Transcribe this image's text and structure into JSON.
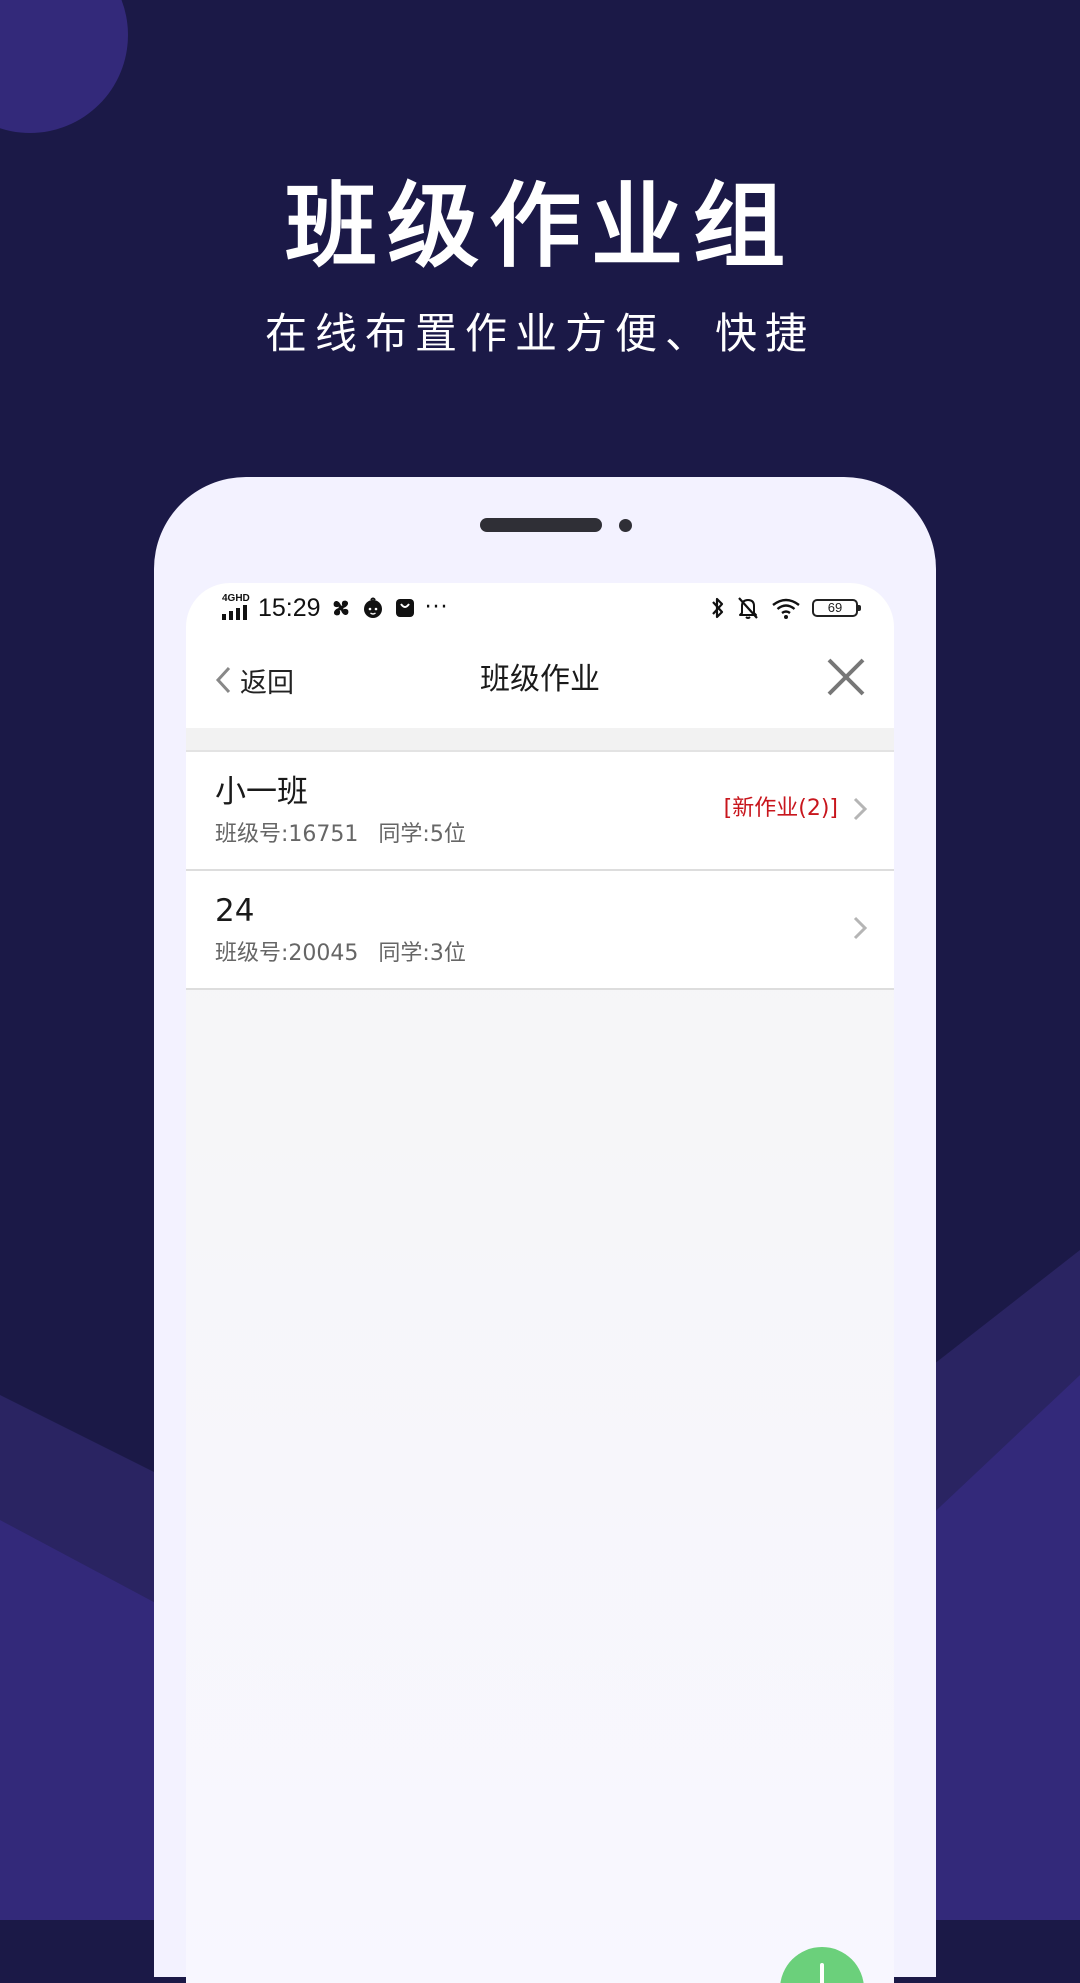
{
  "headline": {
    "title": "班级作业组",
    "subtitle": "在线布置作业方便、快捷"
  },
  "status_bar": {
    "network": "4GHD",
    "time": "15:29",
    "overflow": "···",
    "battery": "69"
  },
  "nav": {
    "back_label": "返回",
    "title": "班级作业"
  },
  "classes": [
    {
      "name": "小一班",
      "class_no": "班级号:16751",
      "students": "同学:5位",
      "badge": "[新作业(2)]"
    },
    {
      "name": "24",
      "class_no": "班级号:20045",
      "students": "同学:3位",
      "badge": ""
    }
  ],
  "colors": {
    "background": "#1b1947",
    "accent_purple": "#33297a",
    "badge_red": "#c8161d",
    "fab_green": "#6bd07b"
  },
  "icons": {
    "back": "chevron-left-icon",
    "close": "close-icon",
    "row_arrow": "chevron-right-icon",
    "fab": "plus-icon"
  }
}
